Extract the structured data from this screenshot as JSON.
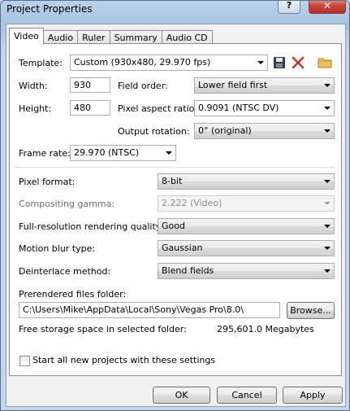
{
  "window": {
    "title": "Project Properties",
    "help_label": "?",
    "close_label": "✕"
  },
  "tabs": [
    "Video",
    "Audio",
    "Ruler",
    "Summary",
    "Audio CD"
  ],
  "video": {
    "template_label": "Template:",
    "template_value": "Custom (930x480, 29.970 fps)",
    "width_label": "Width:",
    "width_value": "930",
    "height_label": "Height:",
    "height_value": "480",
    "field_order_label": "Field order:",
    "field_order_value": "Lower field first",
    "pixel_aspect_label": "Pixel aspect ratio:",
    "pixel_aspect_value": "0.9091 (NTSC DV)",
    "output_rotation_label": "Output rotation:",
    "output_rotation_value": "0° (original)",
    "frame_rate_label": "Frame rate:",
    "frame_rate_value": "29.970 (NTSC)",
    "pixel_format_label": "Pixel format:",
    "pixel_format_value": "8-bit",
    "compositing_gamma_label": "Compositing gamma:",
    "compositing_gamma_value": "2.222 (Video)",
    "render_quality_label": "Full-resolution rendering quality:",
    "render_quality_value": "Good",
    "motion_blur_label": "Motion blur type:",
    "motion_blur_value": "Gaussian",
    "deinterlace_label": "Deinterlace method:",
    "deinterlace_value": "Blend fields",
    "prerender_folder_label": "Prerendered files folder:",
    "prerender_folder_value": "C:\\Users\\Mike\\AppData\\Local\\Sony\\Vegas Pro\\8.0\\",
    "browse_label": "Browse...",
    "free_space_label": "Free storage space in selected folder:",
    "free_space_value": "295,601.0 Megabytes",
    "start_all_label": "Start all new projects with these settings",
    "start_all_checked": false
  },
  "buttons": {
    "ok": "OK",
    "cancel": "Cancel",
    "apply": "Apply"
  },
  "colors": {
    "delete_icon": "#c0392b",
    "folder_icon": "#e8c25a"
  }
}
